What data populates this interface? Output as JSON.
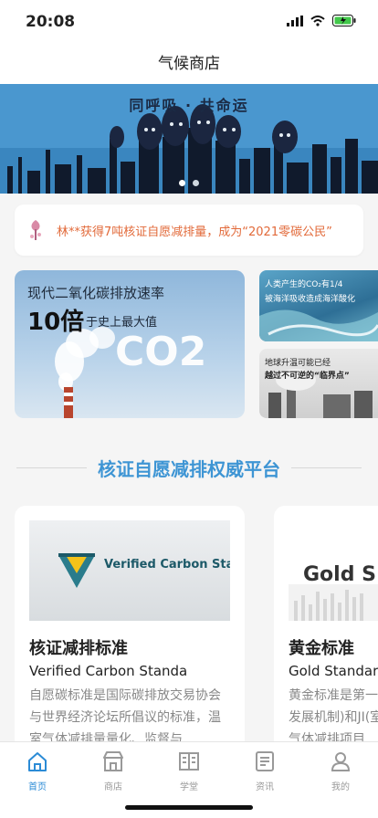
{
  "status": {
    "time": "20:08"
  },
  "nav": {
    "title": "气候商店"
  },
  "banner": {
    "title": "同呼吸 · 共命运",
    "dots": 2,
    "active_dot": 0
  },
  "notice": {
    "text": "林**获得7吨核证自愿减排量，成为“2021零碳公民”"
  },
  "feature_big": {
    "line1": "现代二氧化碳排放速率",
    "big": "10倍",
    "small": "于史上最大值",
    "co2": "CO2"
  },
  "feature_small_1": {
    "line1": "人类产生的CO₂有1/4",
    "line2": "被海洋吸收造成海洋酸化"
  },
  "feature_small_2": {
    "line1": "地球升温可能已经",
    "line2": "越过不可逆的“临界点”"
  },
  "section": {
    "title": "核证自愿减排权威平台"
  },
  "cards": [
    {
      "logo": "Verified Carbon Standard",
      "title": "核证减排标准",
      "subtitle": "Verified Carbon Standa",
      "desc": "自愿碳标准是国际碳排放交易协会与世界经济论坛所倡议的标准，温室气体减排量量化、监督与"
    },
    {
      "logo": "Gold S",
      "title": "黄金标准",
      "subtitle": "Gold Standar",
      "desc": "黄金标准是第一发展机制)和JI(室气体减排项目"
    }
  ],
  "tabs": [
    {
      "label": "首页",
      "icon": "home-icon",
      "active": true
    },
    {
      "label": "商店",
      "icon": "store-icon",
      "active": false
    },
    {
      "label": "学堂",
      "icon": "book-icon",
      "active": false
    },
    {
      "label": "资讯",
      "icon": "news-icon",
      "active": false
    },
    {
      "label": "我的",
      "icon": "user-icon",
      "active": false
    }
  ],
  "colors": {
    "accent": "#3e95d4",
    "notice": "#e26a3a",
    "tab_active": "#2b8bd6"
  }
}
